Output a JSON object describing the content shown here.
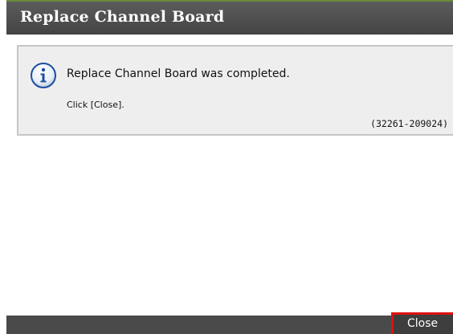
{
  "dialog": {
    "title": "Replace Channel Board",
    "message": {
      "icon": "info-icon",
      "text": "Replace Channel Board was completed.",
      "instruction": "Click [Close].",
      "code": "(32261-209024)"
    },
    "footer": {
      "close_label": "Close"
    }
  },
  "colors": {
    "title_bar": "#4f4f4f",
    "message_background": "#eeeeee",
    "info_icon": "#1c4fa0",
    "close_highlight": "#e01010"
  }
}
